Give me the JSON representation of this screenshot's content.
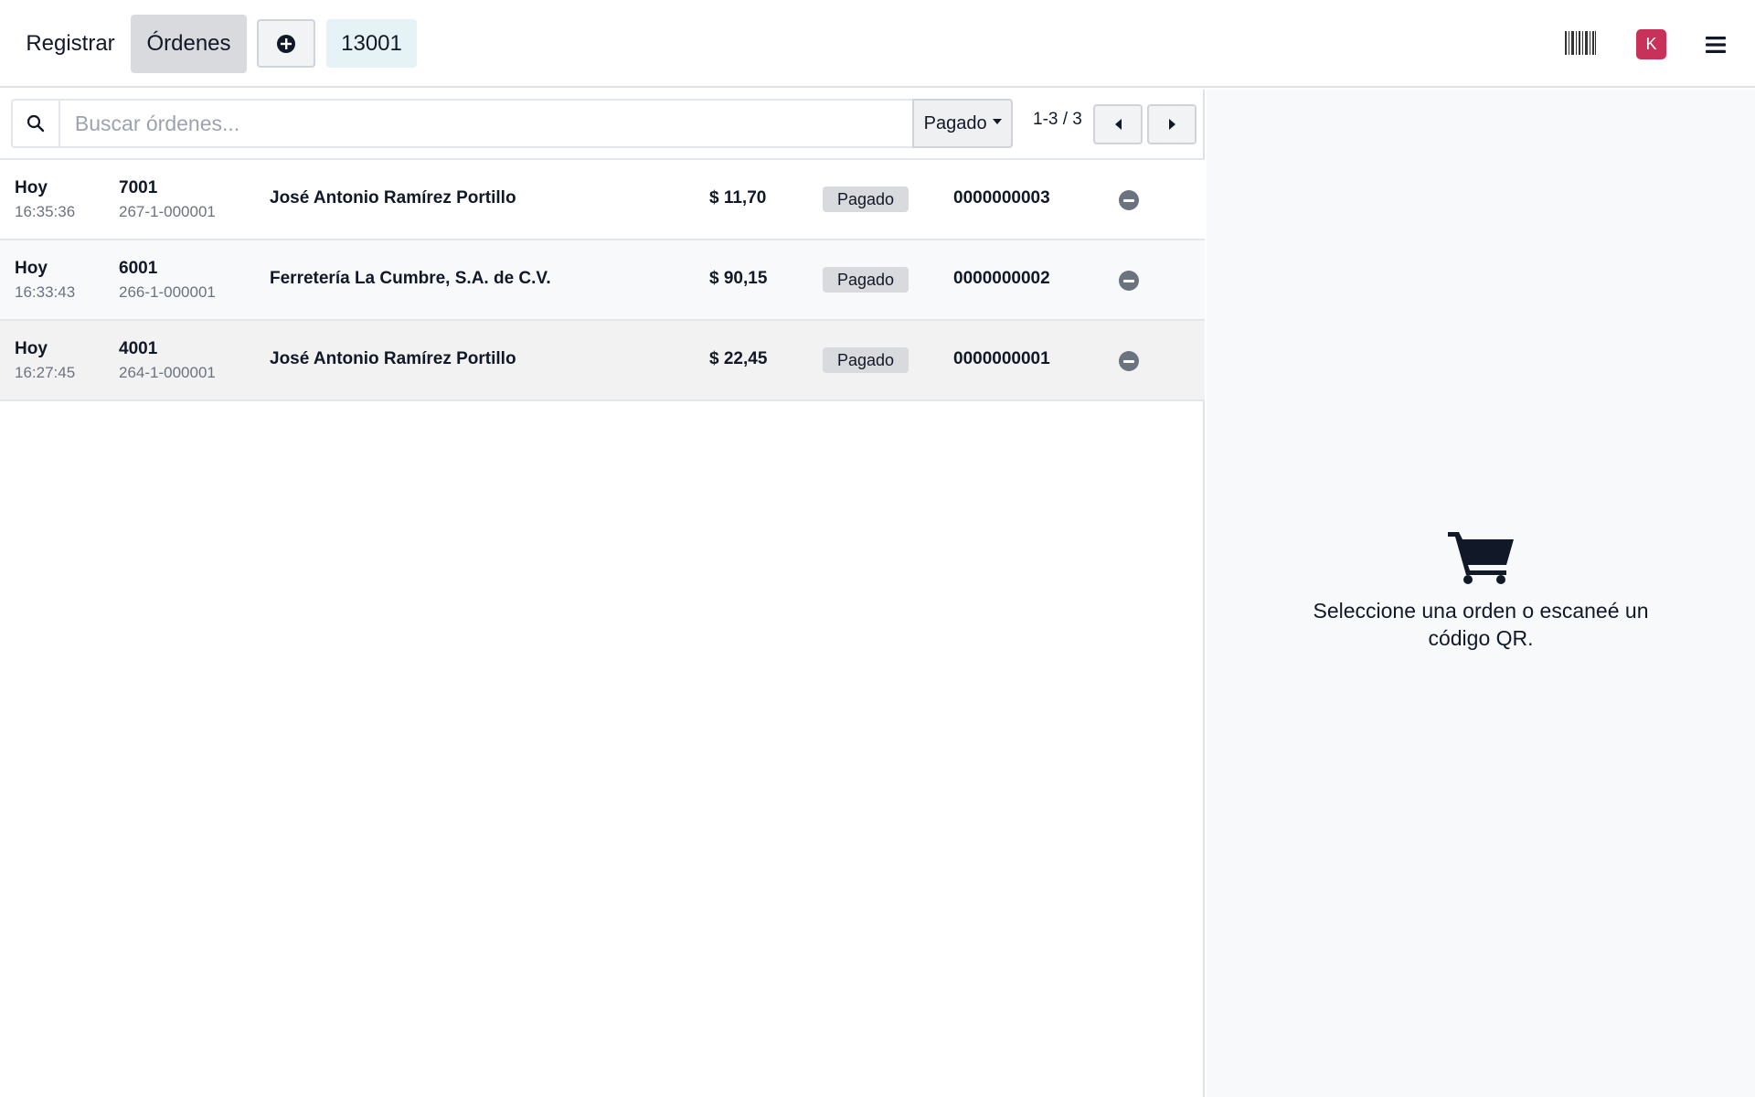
{
  "navbar": {
    "register_label": "Registrar",
    "orders_label": "Órdenes",
    "new_order_icon": "plus-circle-icon",
    "table_number": "13001",
    "barcode_icon": "barcode-icon",
    "avatar_initial": "K",
    "menu_icon": "hamburger-menu-icon"
  },
  "search": {
    "placeholder": "Buscar órdenes...",
    "value": ""
  },
  "filter": {
    "selected": "Pagado"
  },
  "pager": {
    "text": "1-3 / 3"
  },
  "orders": [
    {
      "day": "Hoy",
      "time": "16:35:36",
      "number": "7001",
      "ref": "267-1-000001",
      "client": "José Antonio Ramírez Portillo",
      "total": "$ 11,70",
      "state": "Pagado",
      "receipt": "0000000003"
    },
    {
      "day": "Hoy",
      "time": "16:33:43",
      "number": "6001",
      "ref": "266-1-000001",
      "client": "Ferretería La Cumbre, S.A. de C.V.",
      "total": "$ 90,15",
      "state": "Pagado",
      "receipt": "0000000002"
    },
    {
      "day": "Hoy",
      "time": "16:27:45",
      "number": "4001",
      "ref": "264-1-000001",
      "client": "José Antonio Ramírez Portillo",
      "total": "$ 22,45",
      "state": "Pagado",
      "receipt": "0000000001"
    }
  ],
  "empty_state": {
    "icon": "shopping-cart-icon",
    "line1": "Seleccione una orden o escaneé un",
    "line2": "código QR."
  },
  "colors": {
    "avatar": "#c8315a",
    "active_tab": "#d8dadd",
    "table_badge": "#e6f3f6"
  }
}
